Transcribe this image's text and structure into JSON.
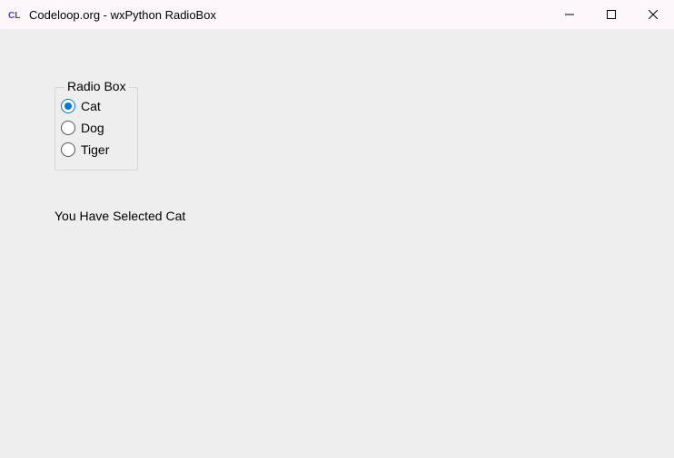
{
  "window": {
    "title": "Codeloop.org - wxPython RadioBox",
    "app_icon_text": "CL"
  },
  "radiobox": {
    "legend": "Radio Box",
    "options": [
      {
        "label": "Cat",
        "selected": true
      },
      {
        "label": "Dog",
        "selected": false
      },
      {
        "label": "Tiger",
        "selected": false
      }
    ]
  },
  "status": {
    "text": "You Have Selected Cat"
  }
}
